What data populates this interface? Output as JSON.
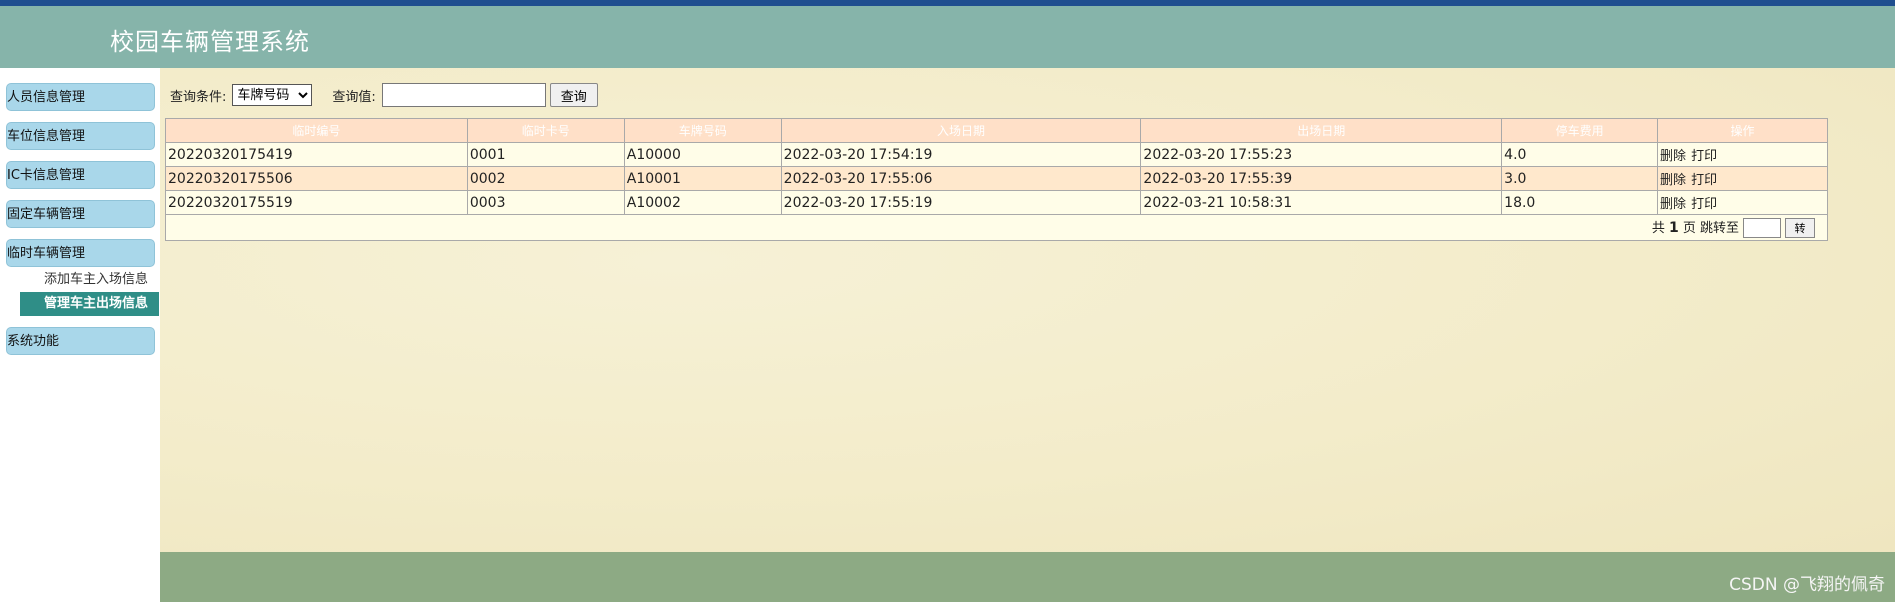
{
  "header": {
    "title": "校园车辆管理系统"
  },
  "sidebar": {
    "items": [
      {
        "label": "人员信息管理"
      },
      {
        "label": "车位信息管理"
      },
      {
        "label": "IC卡信息管理"
      },
      {
        "label": "固定车辆管理"
      },
      {
        "label": "临时车辆管理"
      },
      {
        "label": "系统功能"
      }
    ],
    "sub_items": [
      {
        "label": "添加车主入场信息"
      },
      {
        "label": "管理车主出场信息"
      }
    ]
  },
  "search": {
    "condition_label": "查询条件:",
    "condition_selected": "车牌号码",
    "value_label": "查询值:",
    "value": "",
    "button_label": "查询"
  },
  "table": {
    "headers": [
      "临时编号",
      "临时卡号",
      "车牌号码",
      "入场日期",
      "出场日期",
      "停车费用",
      "操作"
    ],
    "rows": [
      {
        "id": "20220320175419",
        "card": "0001",
        "plate": "A10000",
        "in": "2022-03-20 17:54:19",
        "out": "2022-03-20 17:55:23",
        "fee": "4.0"
      },
      {
        "id": "20220320175506",
        "card": "0002",
        "plate": "A10001",
        "in": "2022-03-20 17:55:06",
        "out": "2022-03-20 17:55:39",
        "fee": "3.0"
      },
      {
        "id": "20220320175519",
        "card": "0003",
        "plate": "A10002",
        "in": "2022-03-20 17:55:19",
        "out": "2022-03-21 10:58:31",
        "fee": "18.0"
      }
    ],
    "ops": {
      "delete_label": "删除",
      "print_label": "打印"
    }
  },
  "pager": {
    "prefix": "共",
    "total_pages": "1",
    "suffix": "页 跳转至",
    "jump_value": "",
    "go_label": "转"
  },
  "footer": {
    "credit": "CSDN @飞翔的佩奇"
  }
}
